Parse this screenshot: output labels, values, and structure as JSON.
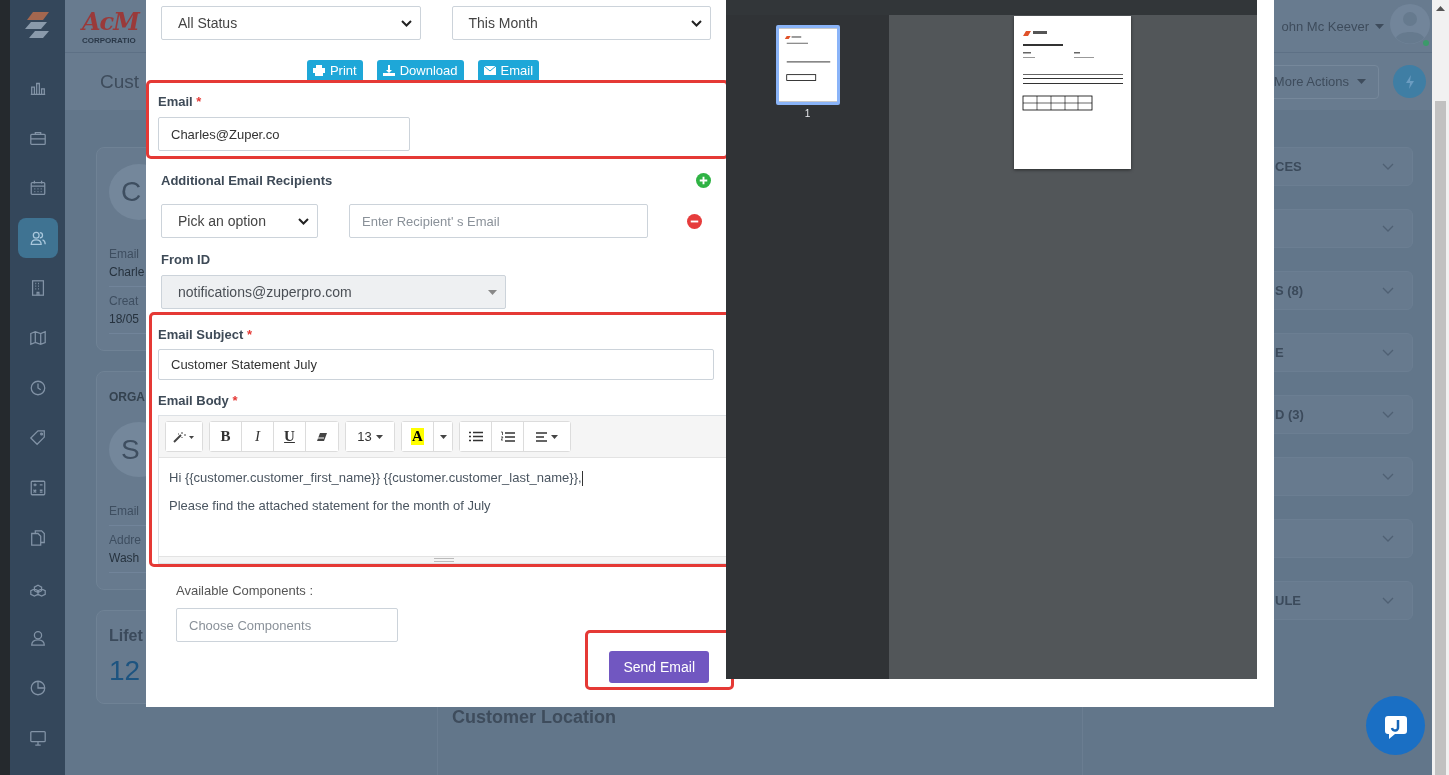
{
  "sidebar": {
    "items": [
      {
        "kind": "chart",
        "selected": false
      },
      {
        "kind": "briefcase",
        "selected": false
      },
      {
        "kind": "calendar",
        "selected": false
      },
      {
        "kind": "contacts",
        "selected": true
      },
      {
        "kind": "building",
        "selected": false
      },
      {
        "kind": "map",
        "selected": false
      },
      {
        "kind": "clock",
        "selected": false
      },
      {
        "kind": "tag",
        "selected": false
      },
      {
        "kind": "calculator",
        "selected": false
      },
      {
        "kind": "documents",
        "selected": false
      },
      {
        "kind": "boxes",
        "selected": false
      },
      {
        "kind": "user",
        "selected": false
      },
      {
        "kind": "history",
        "selected": false
      },
      {
        "kind": "monitor",
        "selected": false
      }
    ]
  },
  "header": {
    "logo": "AcM",
    "logo_tagline": "CORPORATIO",
    "user_name": "ohn Mc Keever",
    "user_online": true
  },
  "page": {
    "title": "Cust",
    "more_actions": "More Actions"
  },
  "customer_card": {
    "avatar": "C",
    "rows": [
      {
        "label": "Email",
        "value": "Charle"
      },
      {
        "label": "Creat",
        "value": "18/05"
      }
    ]
  },
  "organization_card": {
    "heading": "ORGA",
    "avatar": "S",
    "rows": [
      {
        "label": "Email"
      },
      {
        "label": "Addre",
        "value": "Wash"
      }
    ]
  },
  "lifetime_card": {
    "label": "Lifet",
    "value": "12"
  },
  "accordions": [
    {
      "title": "CES",
      "expanded": false
    },
    {
      "expanded": false
    },
    {
      "title": "S (8)",
      "expanded": false
    },
    {
      "title": "E",
      "expanded": false
    },
    {
      "title": "D (3)",
      "expanded": false
    },
    {
      "expanded": false
    },
    {
      "expanded": false
    },
    {
      "title": "ULE",
      "expanded": false
    }
  ],
  "customer_location": {
    "title": "Customer Location"
  },
  "modal": {
    "filters": [
      {
        "value": "All Status"
      },
      {
        "value": "This Month"
      }
    ],
    "actions": [
      {
        "kind": "print",
        "label": "Print"
      },
      {
        "kind": "download",
        "label": "Download"
      },
      {
        "kind": "email",
        "label": "Email"
      }
    ],
    "email": {
      "label": "Email",
      "required_mark": "*",
      "value": "Charles@Zuper.co"
    },
    "recipients": {
      "label": "Additional Email Recipients",
      "rows": [
        {
          "type_placeholder": "Pick an option",
          "email_placeholder": "Enter Recipient' s Email"
        }
      ]
    },
    "from_id": {
      "label": "From ID",
      "value": "notifications@zuperpro.com",
      "disabled": true
    },
    "subject": {
      "label": "Email Subject",
      "required_mark": "*",
      "value": "Customer Statement July"
    },
    "body": {
      "label": "Email Body",
      "required_mark": "*",
      "toolbar": [
        [
          {
            "kind": "style"
          }
        ],
        [
          {
            "kind": "bold",
            "label": "B"
          },
          {
            "kind": "italic",
            "label": "I"
          },
          {
            "kind": "underline",
            "label": "U"
          },
          {
            "kind": "eraser"
          }
        ],
        [
          {
            "kind": "size",
            "label": "13"
          }
        ],
        [
          {
            "kind": "color",
            "label": "A"
          },
          {
            "kind": "color-menu"
          }
        ],
        [
          {
            "kind": "bullets"
          },
          {
            "kind": "numbers"
          },
          {
            "kind": "align"
          }
        ]
      ],
      "paragraphs": [
        "Hi {{customer.customer_first_name}} {{customer.customer_last_name}},",
        "Please find the attached statement for the month of July"
      ]
    },
    "components": {
      "label": "Available Components :",
      "placeholder": "Choose Components"
    },
    "send_button": "Send Email"
  },
  "pdf_viewer": {
    "thumbnails": [
      {
        "page": "1",
        "selected": true
      }
    ]
  }
}
